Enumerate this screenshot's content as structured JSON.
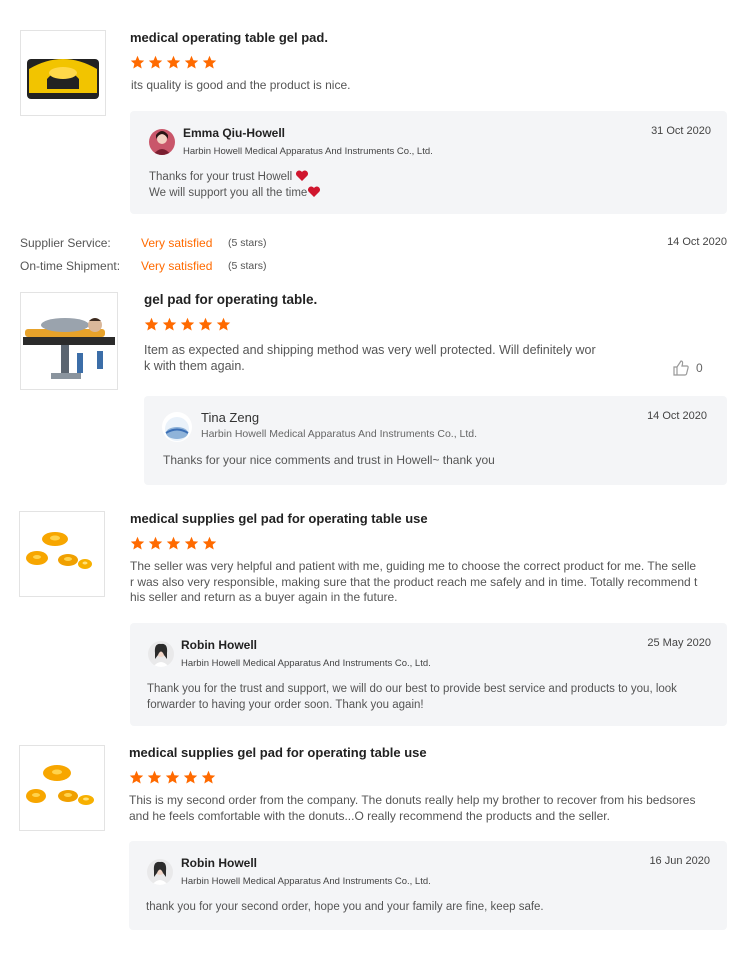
{
  "colors": {
    "accent": "#ff6a00",
    "reply_bg": "#f4f5f7",
    "heart": "#d0162e"
  },
  "reviews": [
    {
      "title": "medical operating table gel pad.",
      "rating": 5,
      "text": "its quality is good and the product is nice.",
      "reply": {
        "name": "Emma Qiu-Howell",
        "company": "Harbin Howell Medical Apparatus And Instruments Co., Ltd.",
        "date": "31 Oct 2020",
        "line1": "Thanks for your trust Howell",
        "line2": "We will support you all the time"
      }
    },
    {
      "supplier_service_label": "Supplier Service:",
      "supplier_service_value": "Very satisfied",
      "supplier_service_stars": "(5 stars)",
      "shipment_label": "On-time Shipment:",
      "shipment_value": "Very satisfied",
      "shipment_stars": "(5 stars)",
      "date": "14 Oct 2020",
      "title": "gel pad for operating table.",
      "rating": 5,
      "text_line1": "Item as expected and shipping method was very well protected. Will definitely wor",
      "text_line2": "k with them again.",
      "likes": "0",
      "reply": {
        "name": "Tina Zeng",
        "company": "Harbin Howell Medical Apparatus And Instruments Co., Ltd.",
        "date": "14 Oct 2020",
        "text": "Thanks for your nice comments and trust in Howell~ thank you"
      }
    },
    {
      "title": "medical supplies gel pad for operating table use",
      "rating": 5,
      "text_line1": "The seller was very helpful and patient with me, guiding me to choose the correct product for me. The selle",
      "text_line2": "r was also very responsible, making sure that the product reach me safely and in time. Totally recommend t",
      "text_line3": "his seller and return as a buyer again in the future.",
      "reply": {
        "name": "Robin Howell",
        "company": "Harbin Howell Medical Apparatus And Instruments Co., Ltd.",
        "date": "25 May 2020",
        "line1": "Thank you for the trust and support, we will do our best to provide best service and products to you, look",
        "line2": "forwarder to having your order soon. Thank you again!"
      }
    },
    {
      "title": "medical supplies gel pad for operating table use",
      "rating": 5,
      "text_line1": "This is my second order from the company. The donuts really help my brother to recover from his bedsores",
      "text_line2": "and he feels comfortable with the donuts...O really recommend the products and the seller.",
      "reply": {
        "name": "Robin Howell",
        "company": "Harbin Howell Medical Apparatus And Instruments Co., Ltd.",
        "date": "16 Jun 2020",
        "text": "thank you for your second order, hope you and your family are fine, keep safe."
      }
    }
  ]
}
